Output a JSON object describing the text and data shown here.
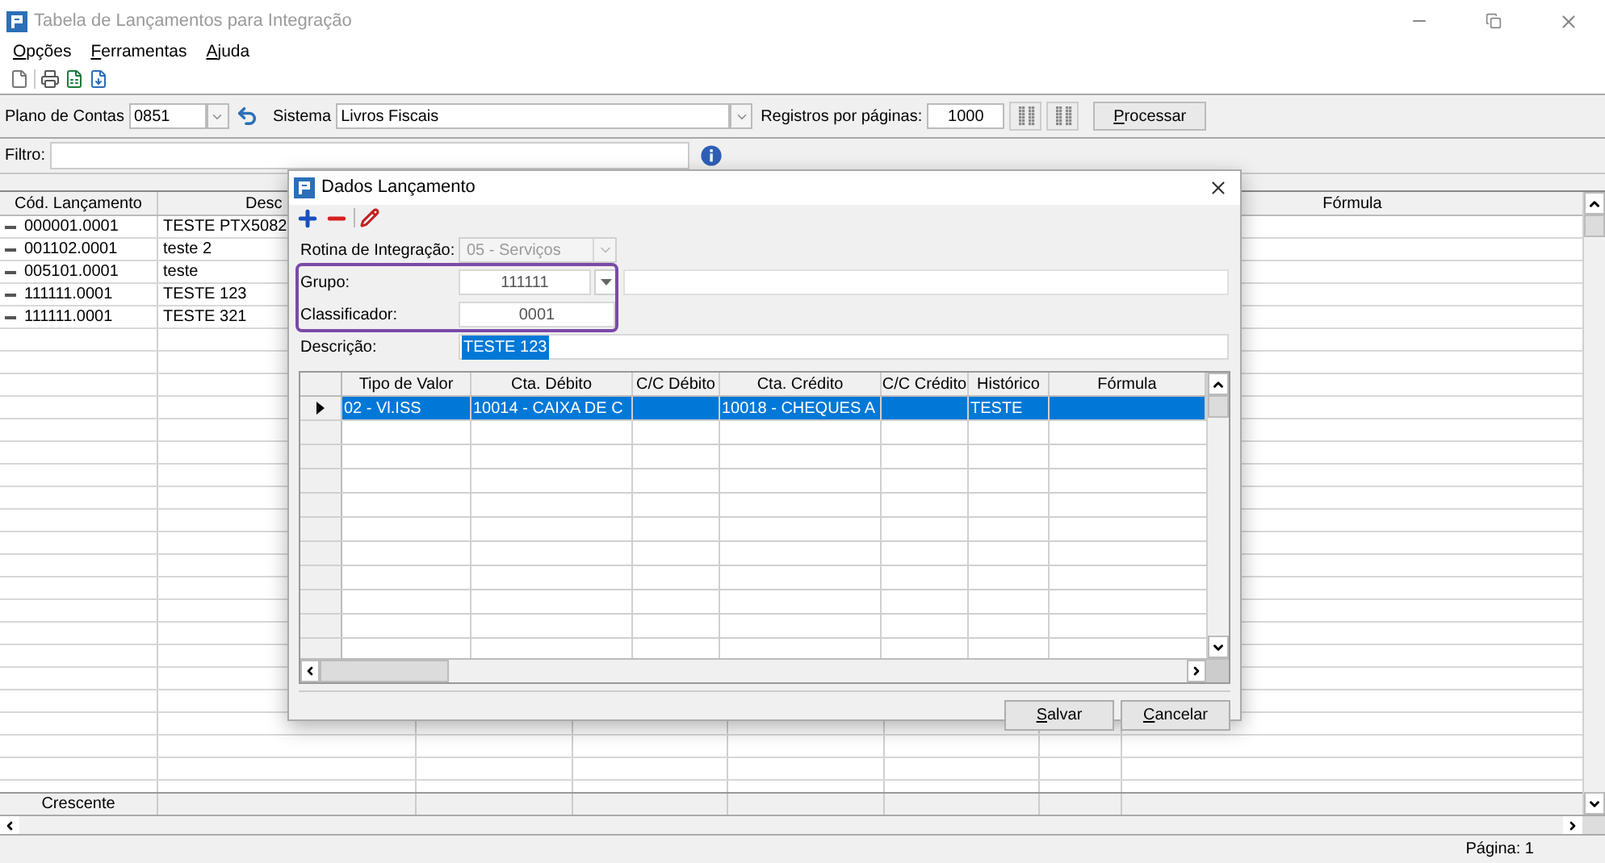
{
  "window": {
    "title": "Tabela de Lançamentos para Integração"
  },
  "menu": [
    {
      "label": "Opções"
    },
    {
      "label": "Ferramentas"
    },
    {
      "label": "Ajuda"
    }
  ],
  "params": {
    "plan_label": "Plano de Contas",
    "plan_value": "0851",
    "system_label": "Sistema",
    "system_value": "Livros Fiscais",
    "per_page_label": "Registros por páginas:",
    "per_page_value": "1000",
    "process_button": "Processar"
  },
  "filter": {
    "label": "Filtro:"
  },
  "grid": {
    "columns": [
      {
        "label": "Cód. Lançamento"
      },
      {
        "label": "Desc"
      },
      {
        "label": "Fórmula"
      }
    ],
    "rows": [
      {
        "code": "000001.0001",
        "description": "TESTE PTX5082"
      },
      {
        "code": "001102.0001",
        "description": "teste 2"
      },
      {
        "code": "005101.0001",
        "description": "teste"
      },
      {
        "code": "111111.0001",
        "description": "TESTE 123"
      },
      {
        "code": "111111.0001",
        "description": "TESTE 321"
      }
    ],
    "footer": "Crescente"
  },
  "status_bar": {
    "page": "Página: 1"
  },
  "dialog": {
    "title": "Dados Lançamento",
    "fields": [
      {
        "kind": "combo",
        "label": "Rotina de Integração:",
        "value": "05 - Serviços",
        "disabled": true,
        "highlighted": false,
        "text_selected": false
      },
      {
        "kind": "lookup",
        "label": "Grupo:",
        "value": "111111",
        "disabled": false,
        "highlighted": true,
        "text_selected": false
      },
      {
        "kind": "short",
        "label": "Classificador:",
        "value": "0001",
        "disabled": false,
        "highlighted": true,
        "text_selected": false
      },
      {
        "kind": "wide",
        "label": "Descrição:",
        "value": "TESTE 123",
        "disabled": false,
        "highlighted": false,
        "text_selected": true
      }
    ],
    "table": {
      "columns": [
        {
          "label": "Tipo de Valor"
        },
        {
          "label": "Cta. Débito"
        },
        {
          "label": "C/C Débito"
        },
        {
          "label": "Cta. Crédito"
        },
        {
          "label": "C/C Crédito"
        },
        {
          "label": "Histórico"
        },
        {
          "label": "Fórmula"
        }
      ],
      "rows": [
        {
          "selected": true,
          "cells": [
            "02 - Vl.ISS",
            "10014 - CAIXA DE C",
            "",
            "10018 - CHEQUES A",
            "",
            "TESTE",
            ""
          ]
        }
      ]
    },
    "buttons": [
      {
        "label": "Salvar"
      },
      {
        "label": "Cancelar"
      }
    ]
  }
}
